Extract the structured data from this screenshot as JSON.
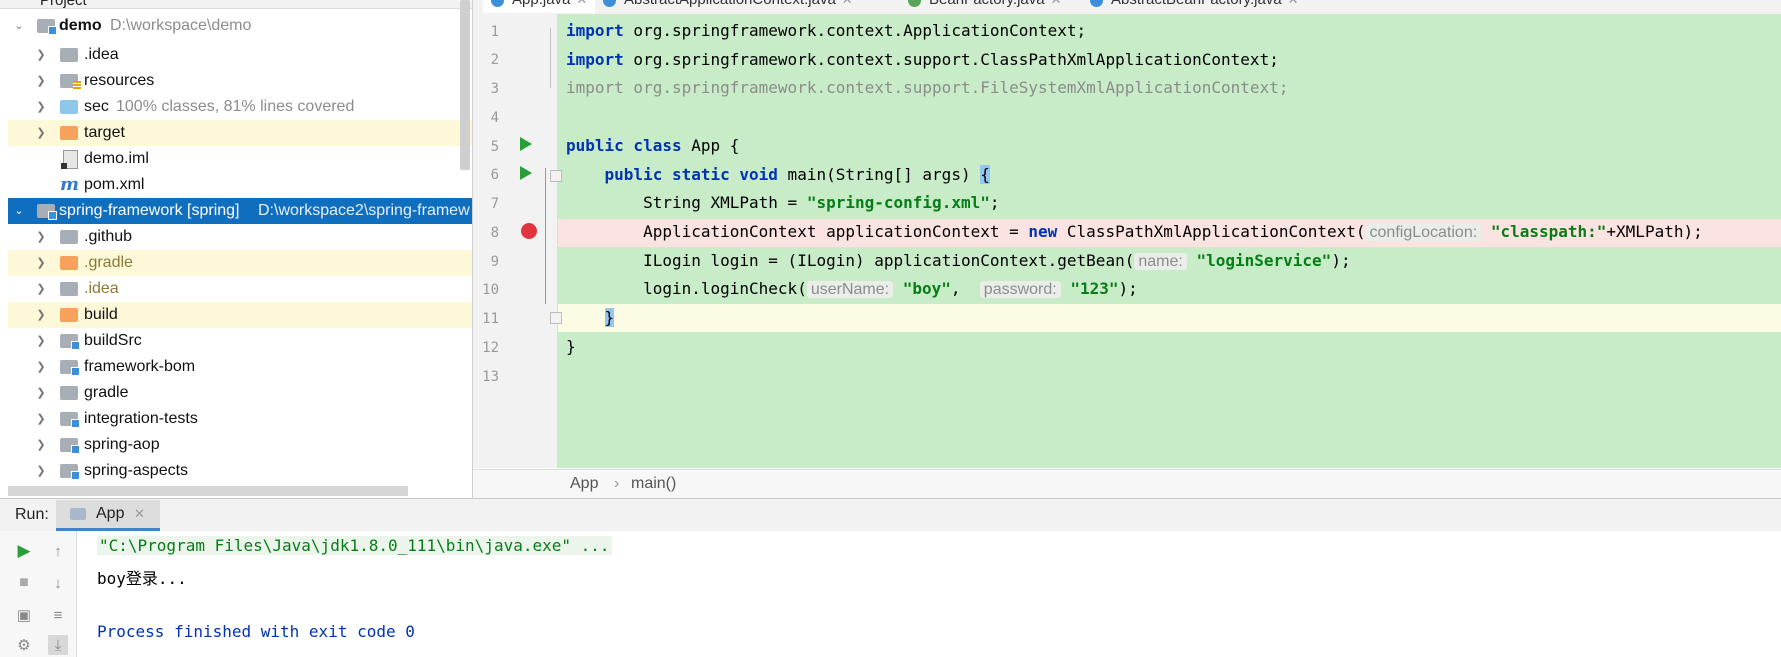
{
  "project_panel": {
    "title": "Project",
    "rows": [
      {
        "label": "demo",
        "hint": "D:\\workspace\\demo"
      },
      {
        "label": ".idea"
      },
      {
        "label": "resources"
      },
      {
        "label": "sec",
        "hint": "100% classes, 81% lines covered"
      },
      {
        "label": "target"
      },
      {
        "label": "demo.iml"
      },
      {
        "label": "pom.xml"
      },
      {
        "label": "spring-framework [spring]",
        "hint": "D:\\workspace2\\spring-framew"
      },
      {
        "label": ".github"
      },
      {
        "label": ".gradle"
      },
      {
        "label": ".idea"
      },
      {
        "label": "build"
      },
      {
        "label": "buildSrc"
      },
      {
        "label": "framework-bom"
      },
      {
        "label": "gradle"
      },
      {
        "label": "integration-tests"
      },
      {
        "label": "spring-aop"
      },
      {
        "label": "spring-aspects"
      }
    ]
  },
  "editor": {
    "tabs": [
      {
        "label": "App.java"
      },
      {
        "label": "AbstractApplicationContext.java"
      },
      {
        "label": "BeanFactory.java"
      },
      {
        "label": "AbstractBeanFactory.java"
      }
    ],
    "line_numbers": [
      "1",
      "2",
      "3",
      "4",
      "5",
      "6",
      "7",
      "8",
      "9",
      "10",
      "11",
      "12",
      "13"
    ],
    "code": {
      "l1_kw": "import",
      "l1_rest": " org.springframework.context.ApplicationContext;",
      "l2_kw": "import",
      "l2_rest": " org.springframework.context.support.ClassPathXmlApplicationContext;",
      "l3": "import org.springframework.context.support.FileSystemXmlApplicationContext;",
      "l5_kw": "public class",
      "l5_rest": " App {",
      "l6_indent": "    ",
      "l6_kw": "public static void",
      "l6_rest": " main(String[] args) ",
      "l6_brace": "{",
      "l7_pre": "        String XMLPath = ",
      "l7_str": "\"spring-config.xml\"",
      "l7_post": ";",
      "l8_pre": "        ApplicationContext applicationContext = ",
      "l8_kw": "new",
      "l8_mid": " ClassPathXmlApplicationContext(",
      "l8_hint": "configLocation:",
      "l8_str": "\"classpath:\"",
      "l8_post": "+XMLPath);",
      "l9_pre": "        ILogin login = (ILogin) applicationContext.getBean(",
      "l9_hint": "name:",
      "l9_str": "\"loginService\"",
      "l9_post": ");",
      "l10_pre": "        login.loginCheck(",
      "l10_hint1": "userName:",
      "l10_str1": "\"boy\"",
      "l10_sep": ",  ",
      "l10_hint2": "password:",
      "l10_str2": "\"123\"",
      "l10_post": ");",
      "l11_indent": "    ",
      "l11_brace": "}",
      "l12": "}"
    },
    "breadcrumb": [
      "App",
      "›",
      "main()"
    ]
  },
  "run_panel": {
    "label": "Run:",
    "tab": "App",
    "console": [
      "\"C:\\Program Files\\Java\\jdk1.8.0_111\\bin\\java.exe\" ...",
      "boy登录...",
      "",
      "Process finished with exit code 0"
    ]
  },
  "colors": {
    "selection": "#0f6ebe",
    "code_background": "#c8ebc8",
    "breakpoint_line": "#fae3e0",
    "keyword": "#0033b3",
    "string": "#067d17"
  }
}
